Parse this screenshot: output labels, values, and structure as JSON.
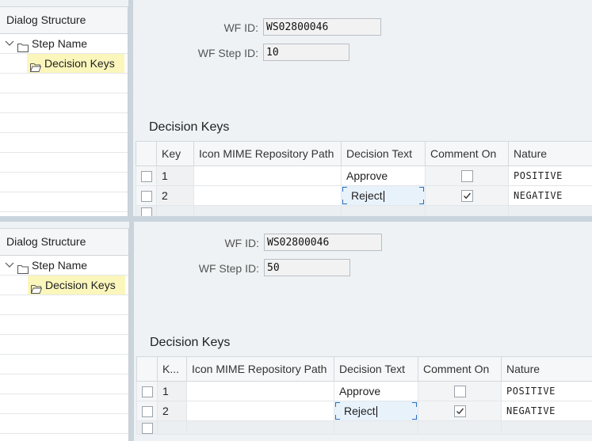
{
  "panels": [
    {
      "tree": {
        "header": "Dialog Structure",
        "items": [
          {
            "label": "Step Name",
            "icon": "folder-icon",
            "expanded": true
          },
          {
            "label": "Decision Keys",
            "icon": "folder-open-icon",
            "selected": true
          }
        ]
      },
      "form": {
        "wf_id_label": "WF ID:",
        "wf_id_value": "WS02800046",
        "step_id_label": "WF Step ID:",
        "step_id_value": "10"
      },
      "section_title": "Decision Keys",
      "table": {
        "headers": [
          "Key",
          "Icon MIME Repository Path",
          "Decision Text",
          "Comment On",
          "Nature"
        ],
        "rows": [
          {
            "key": "1",
            "icon_path": "",
            "decision_text": "Approve",
            "comment_on": false,
            "nature": "POSITIVE"
          },
          {
            "key": "2",
            "icon_path": "",
            "decision_text": "Reject",
            "comment_on": true,
            "nature": "NEGATIVE"
          }
        ]
      }
    },
    {
      "tree": {
        "header": "Dialog Structure",
        "items": [
          {
            "label": "Step Name",
            "icon": "folder-icon",
            "expanded": true
          },
          {
            "label": "Decision Keys",
            "icon": "folder-open-icon",
            "selected": true
          }
        ]
      },
      "form": {
        "wf_id_label": "WF ID:",
        "wf_id_value": "WS02800046",
        "step_id_label": "WF Step ID:",
        "step_id_value": "50"
      },
      "section_title": "Decision Keys",
      "table": {
        "headers": [
          "K...",
          "Icon MIME Repository Path",
          "Decision Text",
          "Comment On",
          "Nature"
        ],
        "rows": [
          {
            "key": "1",
            "icon_path": "",
            "decision_text": "Approve",
            "comment_on": false,
            "nature": "POSITIVE"
          },
          {
            "key": "2",
            "icon_path": "",
            "decision_text": "Reject",
            "comment_on": true,
            "nature": "NEGATIVE"
          }
        ]
      }
    }
  ],
  "colors": {
    "selection": "#fbf6bc",
    "editing": "#e8f2fb",
    "focus": "#2a6ebb"
  }
}
